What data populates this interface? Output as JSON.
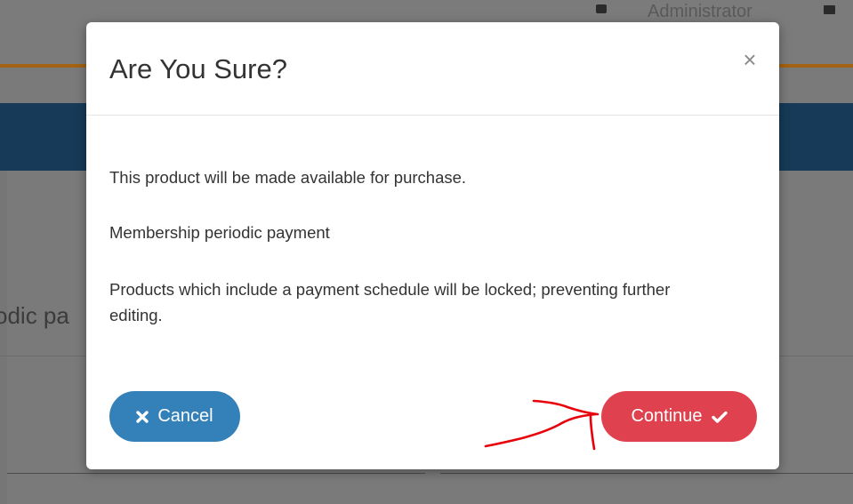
{
  "background": {
    "user_name": "Administrator",
    "page_heading_fragment": "odic pa"
  },
  "modal": {
    "title": "Are You Sure?",
    "close_glyph": "×",
    "body": {
      "line1": "This product will be made available for purchase.",
      "line2": "Membership periodic payment",
      "line3": "Products which include a payment schedule will be locked; preventing further editing."
    },
    "buttons": {
      "cancel_label": "Cancel",
      "cancel_icon": "times-icon",
      "continue_label": "Continue",
      "continue_icon": "check-icon"
    }
  },
  "colors": {
    "cancel_button": "#3481ba",
    "continue_button": "#e0414f",
    "header_band": "#163a58",
    "accent_line": "#a46312",
    "annotation": "#e8000a"
  }
}
